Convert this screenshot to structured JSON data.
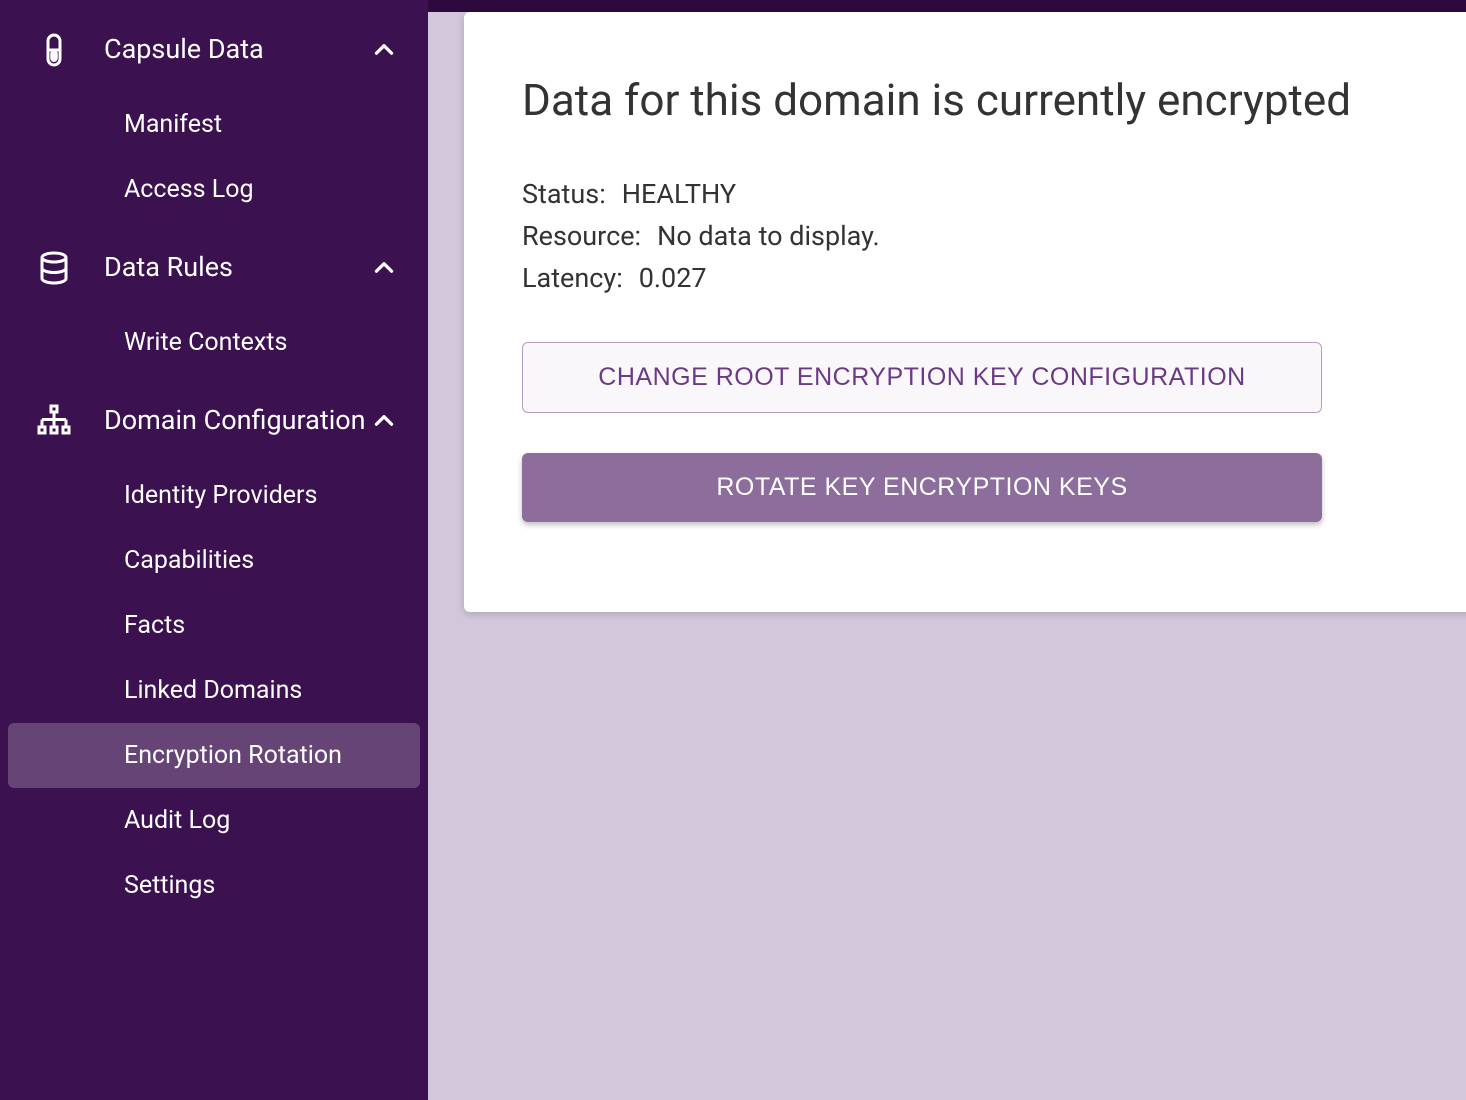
{
  "sidebar": {
    "sections": [
      {
        "label": "Capsule Data",
        "icon": "capsule",
        "items": [
          {
            "label": "Manifest",
            "active": false
          },
          {
            "label": "Access Log",
            "active": false
          }
        ]
      },
      {
        "label": "Data Rules",
        "icon": "database",
        "items": [
          {
            "label": "Write Contexts",
            "active": false
          }
        ]
      },
      {
        "label": "Domain Configuration",
        "icon": "sitemap",
        "items": [
          {
            "label": "Identity Providers",
            "active": false
          },
          {
            "label": "Capabilities",
            "active": false
          },
          {
            "label": "Facts",
            "active": false
          },
          {
            "label": "Linked Domains",
            "active": false
          },
          {
            "label": "Encryption Rotation",
            "active": true
          },
          {
            "label": "Audit Log",
            "active": false
          },
          {
            "label": "Settings",
            "active": false
          }
        ]
      }
    ]
  },
  "main": {
    "title": "Data for this domain is currently encrypted",
    "rows": [
      {
        "label": "Status",
        "value": "HEALTHY"
      },
      {
        "label": "Resource",
        "value": "No data to display."
      },
      {
        "label": "Latency",
        "value": "0.027"
      }
    ],
    "buttons": {
      "change_key": "Change root encryption key configuration",
      "rotate_key": "Rotate key encryption keys"
    }
  },
  "colors": {
    "sidebar_bg": "#3b1150",
    "page_bg": "#d3c7db",
    "accent": "#6a3a84",
    "btn_solid": "#8c6d9b"
  }
}
